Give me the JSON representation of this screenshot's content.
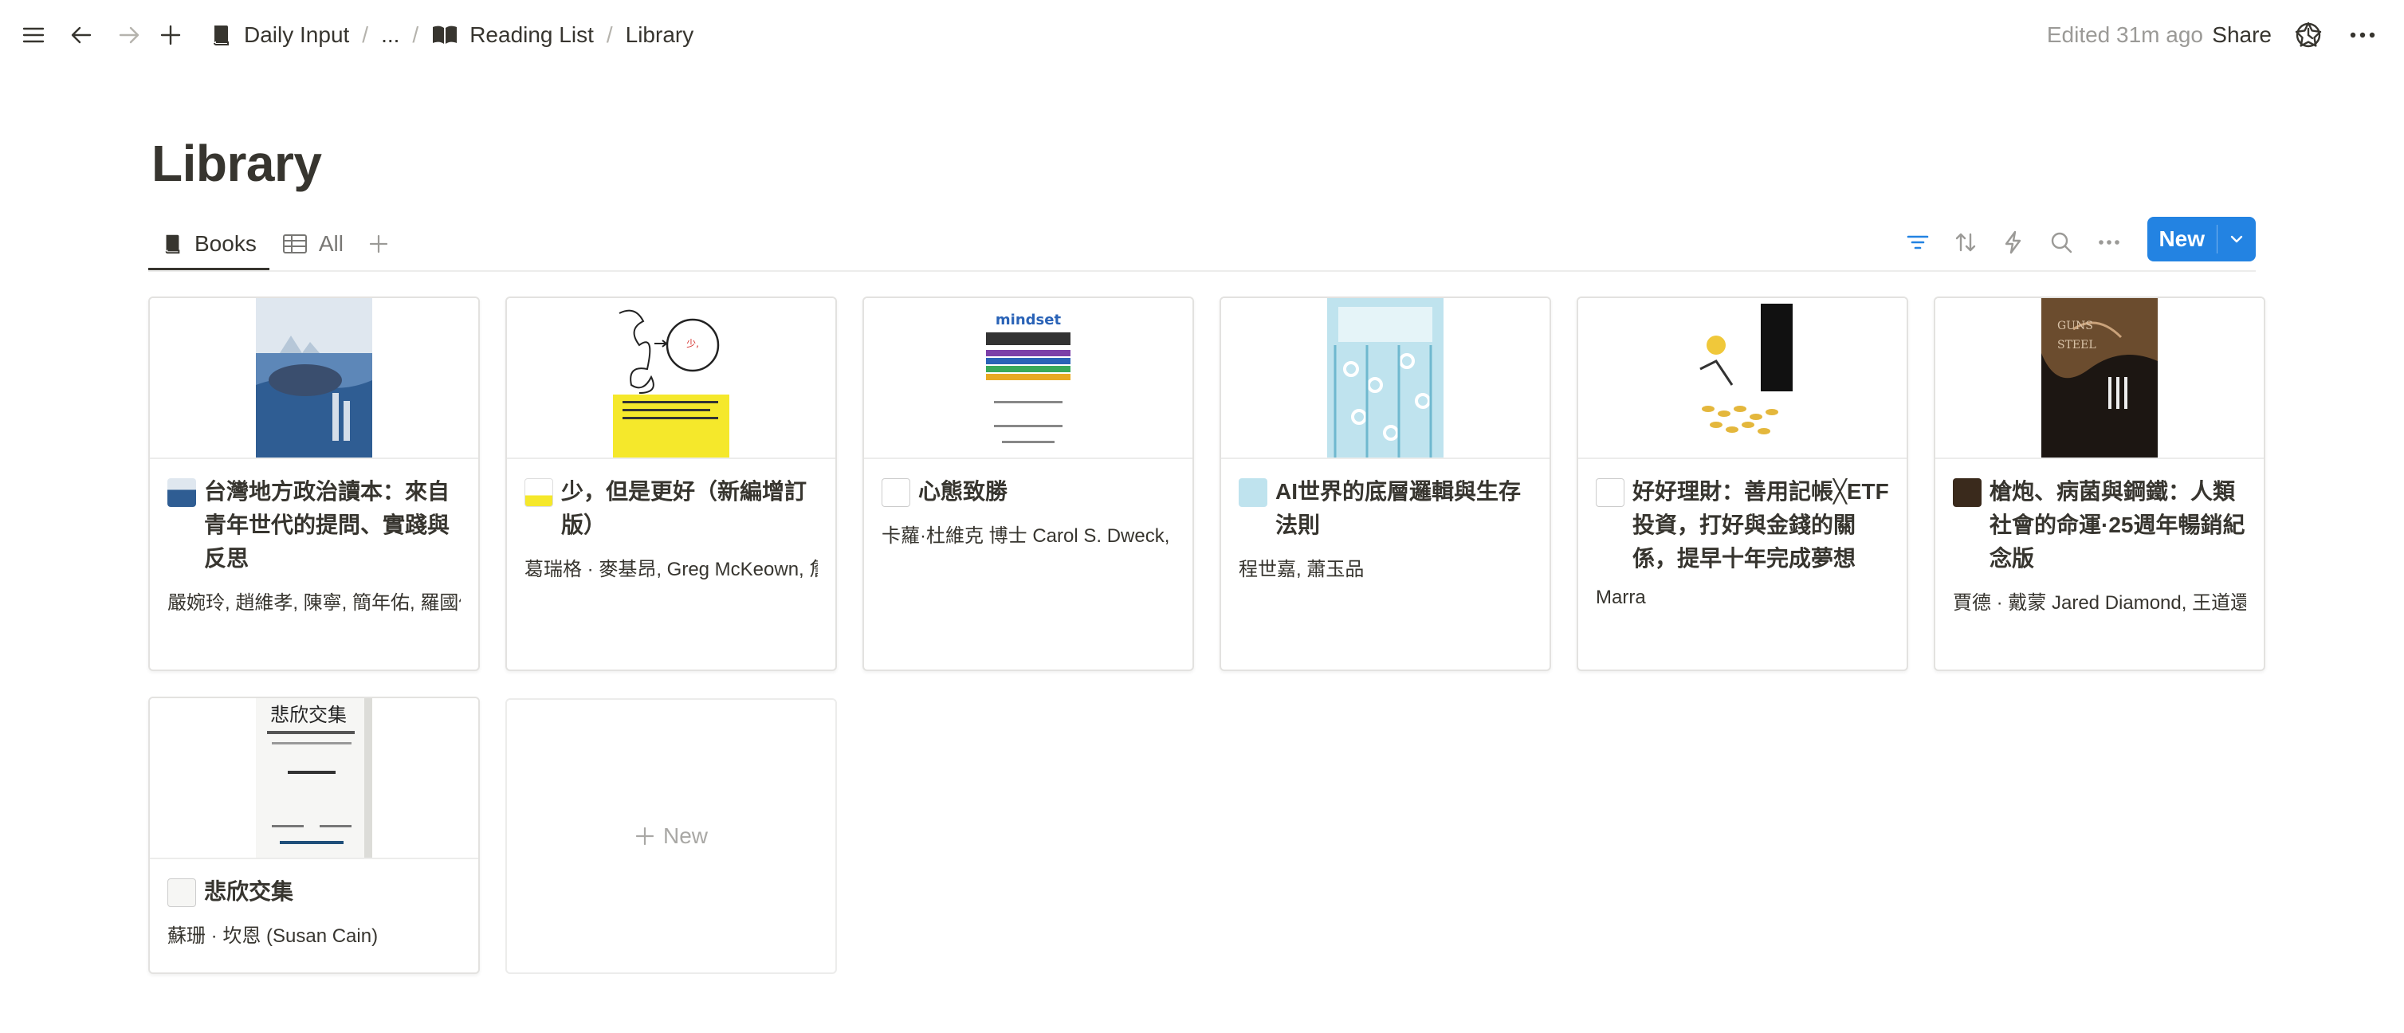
{
  "topbar": {
    "breadcrumbs": [
      "Daily Input",
      "...",
      "Reading List",
      "Library"
    ],
    "edited": "Edited 31m ago",
    "share": "Share"
  },
  "page": {
    "title": "Library"
  },
  "views": {
    "tabs": [
      {
        "label": "Books",
        "icon": "book-icon",
        "active": true
      },
      {
        "label": "All",
        "icon": "table-icon",
        "active": false
      }
    ]
  },
  "toolbar": {
    "new_label": "New"
  },
  "cards": [
    {
      "title": "台灣地方政治讀本：來自青年世代的提問、實踐與反思",
      "author": "嚴婉玲, 趙維孝, 陳寧, 簡年佑, 羅國儲"
    },
    {
      "title": "少，但是更好（新編增訂版）",
      "author": "葛瑞格 · 麥基昂, Greg McKeown, 詹"
    },
    {
      "title": "心態致勝",
      "author": "卡蘿·杜維克 博士 Carol S. Dweck, P"
    },
    {
      "title": "AI世界的底層邏輯與生存法則",
      "author": "程世嘉, 蕭玉品"
    },
    {
      "title": "好好理財：善用記帳╳ETF投資，打好與金錢的關係，提早十年完成夢想",
      "author": "Marra"
    },
    {
      "title": "槍炮、病菌與鋼鐵：人類社會的命運·25週年暢銷紀念版",
      "author": "賈德 · 戴蒙 Jared Diamond, 王道還,"
    },
    {
      "title": "悲欣交集",
      "author": "蘇珊 · 坎恩 (Susan Cain)"
    }
  ],
  "new_card_label": "New",
  "colors": {
    "accent": "#2383e2",
    "text": "#37352f",
    "muted": "#9b9a97"
  }
}
